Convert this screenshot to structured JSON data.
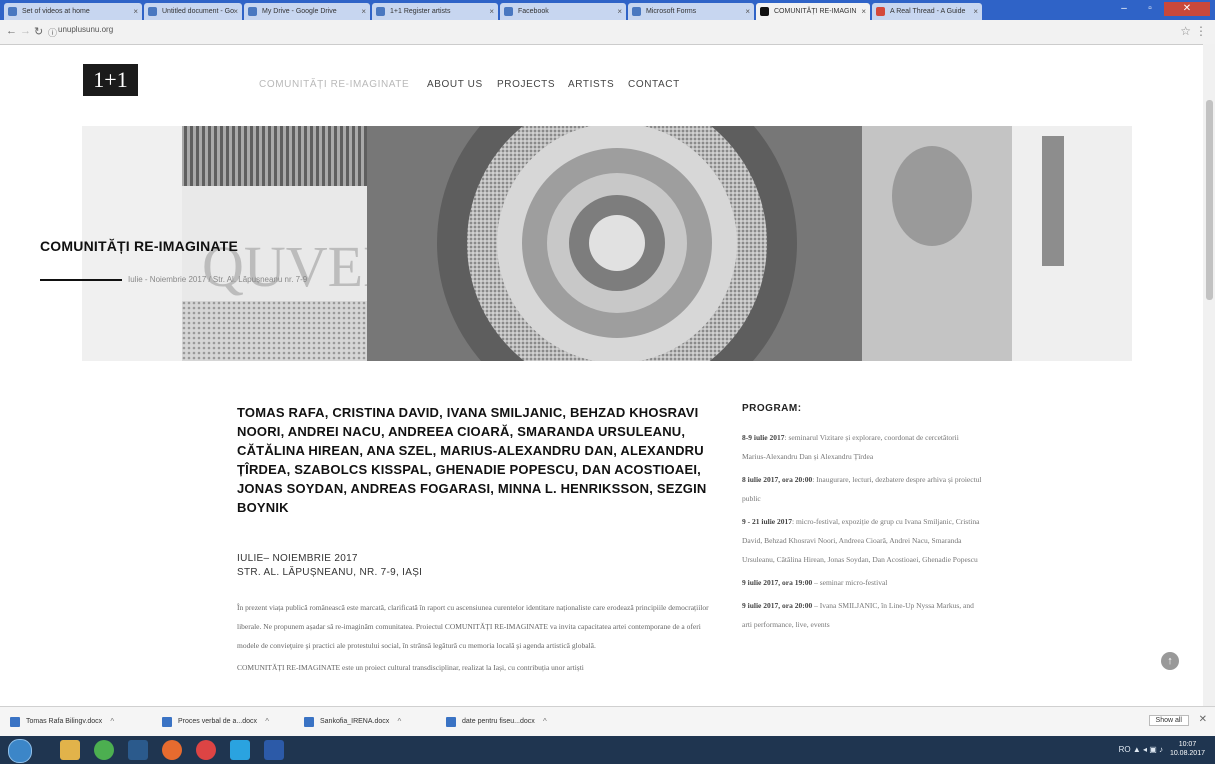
{
  "browser": {
    "tabs": [
      {
        "label": "Set of videos at home",
        "active": false
      },
      {
        "label": "Untitled document - Go",
        "active": false
      },
      {
        "label": "My Drive - Google Drive",
        "active": false
      },
      {
        "label": "1+1 Register artists",
        "active": false
      },
      {
        "label": "Facebook",
        "active": false
      },
      {
        "label": "Microsoft Forms",
        "active": false
      },
      {
        "label": "COMUNITĂȚI RE-IMAGIN",
        "active": true
      },
      {
        "label": "A Real Thread - A Guide",
        "active": false
      }
    ],
    "url": "unuplusunu.org",
    "back_icon": "arrow-left-icon",
    "forward_icon": "arrow-right-icon",
    "reload_icon": "reload-icon"
  },
  "site": {
    "logo": "1+1",
    "nav": [
      {
        "label": "COMUNITĂȚI RE-IMAGINATE",
        "dim": true
      },
      {
        "label": "ABOUT US",
        "dim": false
      },
      {
        "label": "PROJECTS",
        "dim": false
      },
      {
        "label": "ARTISTS",
        "dim": false
      },
      {
        "label": "CONTACT",
        "dim": false
      }
    ]
  },
  "hero": {
    "title": "COMUNITĂȚI RE-IMAGINATE",
    "meta": "Iulie - Noiembrie 2017 / Str. Al. Lăpușneanu nr. 7-9"
  },
  "content": {
    "artists": "TOMAS RAFA, CRISTINA DAVID, IVANA SMILJANIC, BEHZAD KHOSRAVI NOORI, ANDREI NACU, ANDREEA CIOARĂ, SMARANDA URSULEANU, CĂTĂLINA HIREAN, ANA SZEL, MARIUS-ALEXANDRU DAN, ALEXANDRU ȚÎRDEA, SZABOLCS KISSPAL, GHENADIE POPESCU, DAN ACOSTIOAEI, JONAS SOYDAN, ANDREAS FOGARASI, MINNA L. HENRIKSSON, SEZGIN BOYNIK",
    "dates_line1": "IULIE– NOIEMBRIE 2017",
    "dates_line2": "STR. AL. LĂPUȘNEANU, NR. 7-9, IAȘI",
    "body": "În prezent viața publică românească este marcată, clarificată în raport cu ascensiunea curentelor identitare naționaliste care erodează principiile democrațiilor liberale. Ne propunem așadar să re-imaginăm comunitatea. Proiectul COMUNITĂȚI RE-IMAGINATE va invita capacitatea artei contemporane de a oferi modele de convieţuire şi practici ale protestului social, în strânsă legătură cu memoria locală şi agenda artistică globală.",
    "body_cont": "COMUNITĂȚI RE-IMAGINATE este un proiect cultural transdisciplinar, realizat la Iași, cu contribuția unor artiști"
  },
  "program": {
    "heading": "PROGRAM:",
    "items": [
      {
        "date": "8-9 iulie 2017",
        "text": ": seminarul Vizitare și explorare, coordonat de cercetătorii Marius-Alexandru Dan și Alexandru Țîrdea"
      },
      {
        "date": "8 iulie 2017, ora 20:00",
        "text": ": Inaugurare, lecturi, dezbatere despre arhiva și proiectul public"
      },
      {
        "date": "9 - 21 iulie 2017",
        "text": ": micro-festival, expoziție de grup cu Ivana Smiljanic, Cristina David, Behzad Khosravi Noori, Andreea Cioară, Andrei Nacu, Smaranda Ursuleanu, Cătălina Hirean, Jonas Soydan, Dan Acostioaei, Ghenadie Popescu"
      },
      {
        "date": "9 iulie 2017, ora 19:00",
        "text": " – seminar micro-festival"
      },
      {
        "date": "9 iulie 2017, ora 20:00",
        "text": " – Ivana SMILJANIC, în Line-Up Nyssa Markus, and arti performance, live, events"
      }
    ]
  },
  "downloads": [
    {
      "label": "Tomas Rafa Bilingv.docx"
    },
    {
      "label": "Proces verbal de a...docx"
    },
    {
      "label": "Sankofia_IRENA.docx"
    },
    {
      "label": "date pentru fiseu...docx"
    }
  ],
  "downloads_show_all": "Show all",
  "taskbar": {
    "tray": "RO",
    "time": "10:07",
    "date": "10.08.2017"
  },
  "colors": {
    "accent": "#2f63c7",
    "text": "#111111",
    "muted": "#b9b9b9"
  }
}
